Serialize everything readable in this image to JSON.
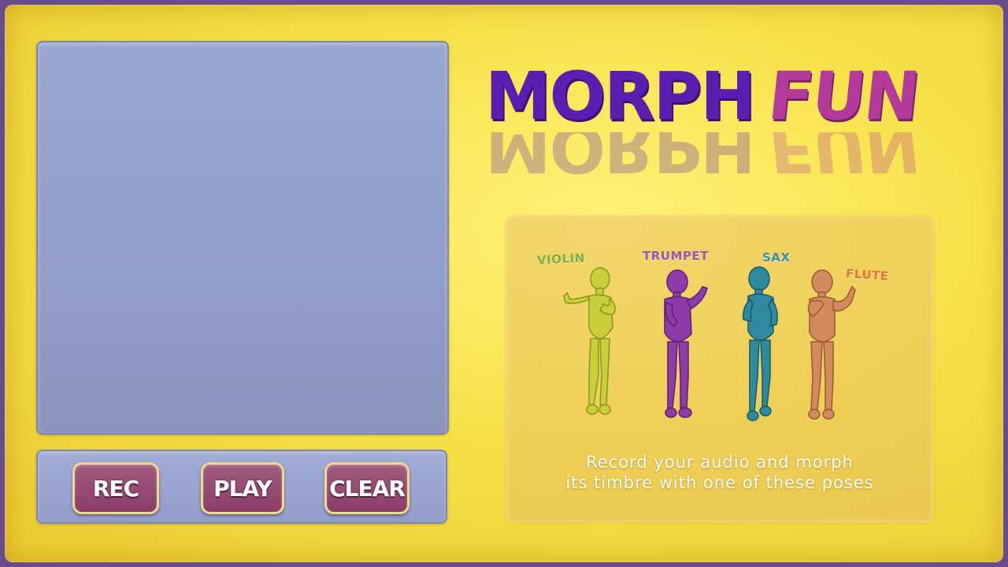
{
  "app": {
    "title_part1": "MORPH",
    "title_part2": "FUN"
  },
  "controls": {
    "rec_label": "REC",
    "play_label": "PLAY",
    "clear_label": "CLEAR"
  },
  "poses": [
    {
      "label": "VIOLIN",
      "color": "#c8cf3a"
    },
    {
      "label": "TRUMPET",
      "color": "#8e3aa8"
    },
    {
      "label": "SAX",
      "color": "#2f8aa0"
    },
    {
      "label": "FLUTE",
      "color": "#d28a5e"
    }
  ],
  "caption": {
    "line1": "Record your audio and morph",
    "line2": "its timbre with one of these poses"
  },
  "colors": {
    "background": "#f7e24a",
    "frame": "#6a4c8c",
    "panel": "#939ec8",
    "button": "#8a3e66",
    "title_morph": "#5a1fb0",
    "title_fun": "#b33a9a"
  }
}
